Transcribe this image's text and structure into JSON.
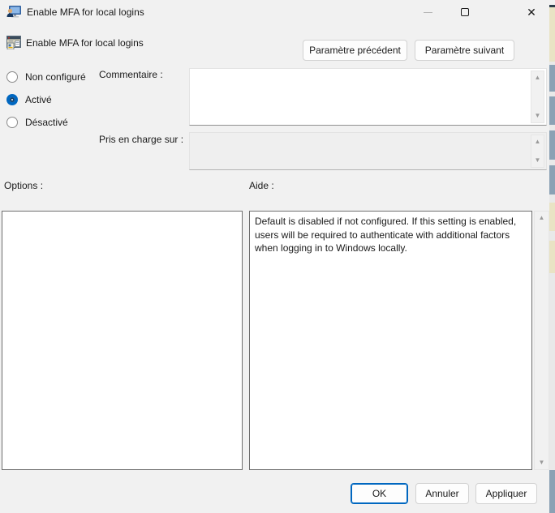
{
  "window": {
    "title": "Enable MFA for local logins",
    "controls": [
      {
        "name": "minimize"
      },
      {
        "name": "maximize"
      },
      {
        "name": "close",
        "glyph": "✕"
      }
    ]
  },
  "header": {
    "setting_name": "Enable MFA for local logins",
    "prev_button": "Paramètre précédent",
    "next_button": "Paramètre suivant"
  },
  "state_options": {
    "items": [
      {
        "label": "Non configuré",
        "selected": false
      },
      {
        "label": "Activé",
        "selected": true
      },
      {
        "label": "Désactivé",
        "selected": false
      }
    ]
  },
  "fields": {
    "comment_label": "Commentaire :",
    "comment_value": "",
    "supported_on_label": "Pris en charge sur :",
    "supported_on_value": ""
  },
  "panels": {
    "options_label": "Options :",
    "help_label": "Aide :",
    "help_text": "Default is disabled if not configured. If this setting is enabled, users will be required to authenticate with additional factors when logging in to Windows locally."
  },
  "footer": {
    "ok": "OK",
    "cancel": "Annuler",
    "apply": "Appliquer"
  },
  "icons": {
    "scroll_up": "▲",
    "scroll_down": "▼"
  },
  "colors": {
    "accent": "#0067c0",
    "dialog_bg": "#f1f1f1",
    "disabled_field_bg": "#efefef"
  }
}
